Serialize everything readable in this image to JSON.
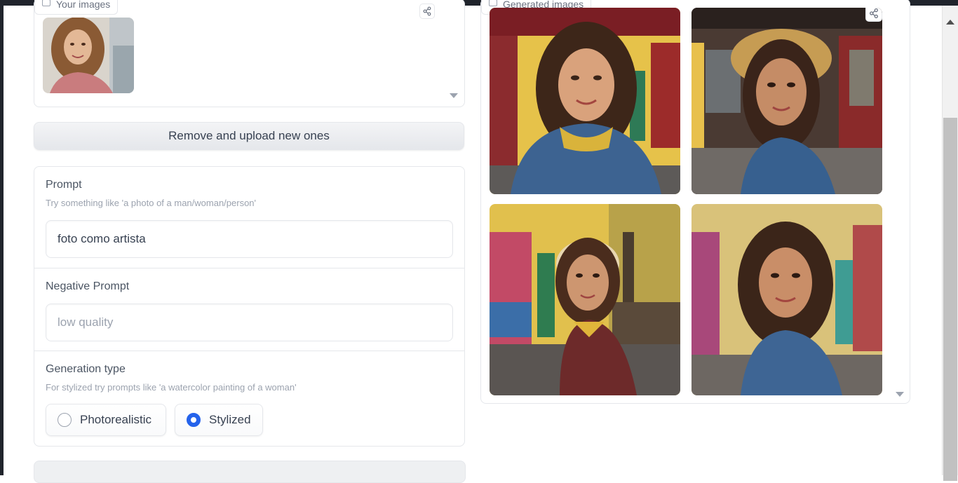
{
  "your_images": {
    "label": "Your images"
  },
  "upload": {
    "remove_label": "Remove and upload new ones"
  },
  "prompt": {
    "label": "Prompt",
    "info": "Try something like 'a photo of a man/woman/person'",
    "value": "foto como artista"
  },
  "negative_prompt": {
    "label": "Negative Prompt",
    "placeholder": "low quality"
  },
  "generation_type": {
    "label": "Generation type",
    "info": "For stylized try prompts like 'a watercolor painting of a woman'",
    "options": [
      "Photorealistic",
      "Stylized"
    ],
    "selected": "Stylized"
  },
  "gallery": {
    "label": "Generated images",
    "count": 4
  },
  "colors": {
    "accent": "#2563eb"
  }
}
